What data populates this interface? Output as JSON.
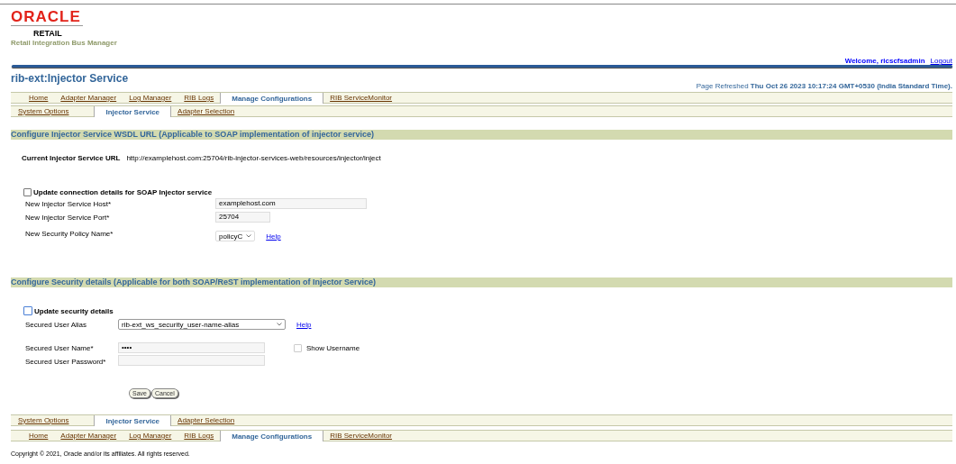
{
  "header": {
    "brand": "ORACLE",
    "product": "RETAIL",
    "subtitle": "Retail Integration Bus Manager",
    "welcome": "Welcome, ricscfsadmin",
    "logout": "Logout"
  },
  "page_title": "rib-ext:Injector Service",
  "refreshed": {
    "label": "Page Refreshed",
    "time": "Thu Oct 26 2023 10:17:24 GMT+0530 (India Standard Time)."
  },
  "tabs": [
    {
      "label": "Home",
      "selected": false
    },
    {
      "label": "Adapter Manager",
      "selected": false
    },
    {
      "label": "Log Manager",
      "selected": false
    },
    {
      "label": "RIB Logs",
      "selected": false
    },
    {
      "label": "Manage Configurations",
      "selected": true
    },
    {
      "label": "RIB ServiceMonitor",
      "selected": false
    }
  ],
  "subtabs": [
    {
      "label": "System Options",
      "selected": false
    },
    {
      "label": "Injector Service",
      "selected": true
    },
    {
      "label": "Adapter Selection",
      "selected": false
    }
  ],
  "wsdl_section": {
    "title": "Configure Injector Service WSDL URL (Applicable to SOAP implementation of injector service)",
    "current_url_label": "Current Injector Service URL",
    "current_url": "http://examplehost.com:25704/rib-injector-services-web/resources/injector/inject",
    "update_checkbox": {
      "label": "Update connection details for SOAP Injector service",
      "checked": false
    },
    "fields": [
      {
        "kind": "text",
        "label": "New Injector Service Host*",
        "value": "examplehost.com"
      },
      {
        "kind": "port",
        "label": "New Injector Service Port*",
        "value": "25704"
      },
      {
        "kind": "select",
        "label": "New Security Policy Name*",
        "value": "policyC",
        "help": "Help"
      }
    ]
  },
  "security_section": {
    "title": "Configure Security details (Applicable for both SOAP/ReST implementation of Injector Service)",
    "update_checkbox": {
      "label": "Update security details",
      "checked": false
    },
    "alias": {
      "label": "Secured User Alias",
      "value": "rib-ext_ws_security_user-name-alias",
      "help": "Help"
    },
    "user_name": {
      "label": "Secured User Name*",
      "value": "••••"
    },
    "show_username": {
      "label": "Show Username",
      "checked": false
    },
    "password": {
      "label": "Secured User Password*"
    },
    "buttons": [
      "Save",
      "Cancel"
    ]
  },
  "footer_subtabs": [
    {
      "label": "System Options",
      "selected": false
    },
    {
      "label": "Injector Service",
      "selected": true
    },
    {
      "label": "Adapter Selection",
      "selected": false
    }
  ],
  "footer_tabs": [
    {
      "label": "Home",
      "selected": false
    },
    {
      "label": "Adapter Manager",
      "selected": false
    },
    {
      "label": "Log Manager",
      "selected": false
    },
    {
      "label": "RIB Logs",
      "selected": false
    },
    {
      "label": "Manage Configurations",
      "selected": true
    },
    {
      "label": "RIB ServiceMonitor",
      "selected": false
    }
  ],
  "copyright": "Copyright © 2021, Oracle and/or its affiliates. All rights reserved."
}
